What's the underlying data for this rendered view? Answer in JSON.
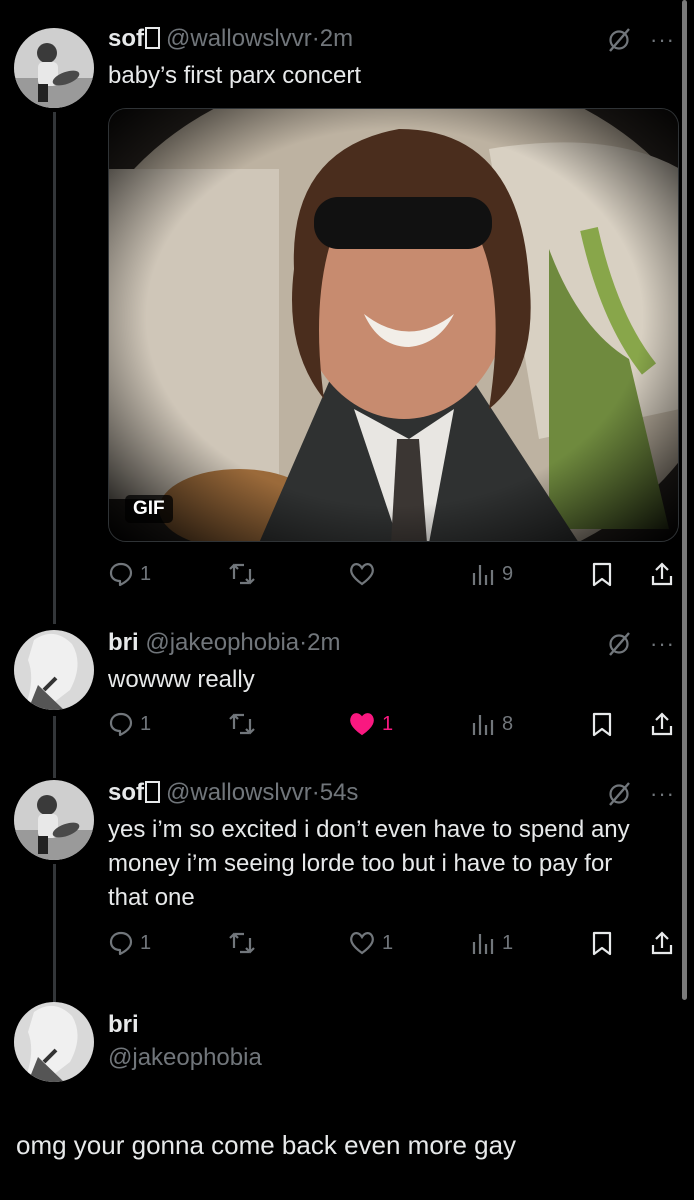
{
  "tweets": [
    {
      "name": "sof",
      "handle": "@wallowslvvr",
      "dot": "·",
      "time": "2m",
      "text": "baby’s first parx concert",
      "media_badge": "GIF",
      "replies": "1",
      "reposts": "",
      "likes": "",
      "views": "9"
    },
    {
      "name": "bri",
      "handle": "@jakeophobia",
      "dot": "·",
      "time": "2m",
      "text": "wowww really",
      "replies": "1",
      "reposts": "",
      "likes": "1",
      "liked": true,
      "views": "8"
    },
    {
      "name": "sof",
      "handle": "@wallowslvvr",
      "dot": "·",
      "time": "54s",
      "text": "yes i’m so excited i don’t even have to spend any money i’m seeing lorde too but i have to pay for that one",
      "replies": "1",
      "reposts": "",
      "likes": "1",
      "views": "1"
    }
  ],
  "focused": {
    "name": "bri",
    "handle": "@jakeophobia",
    "text": "omg your gonna come back even more gay"
  },
  "colors": {
    "background": "#000000",
    "text": "#e7e9ea",
    "muted": "#71767b",
    "like_pink": "#f91880"
  }
}
